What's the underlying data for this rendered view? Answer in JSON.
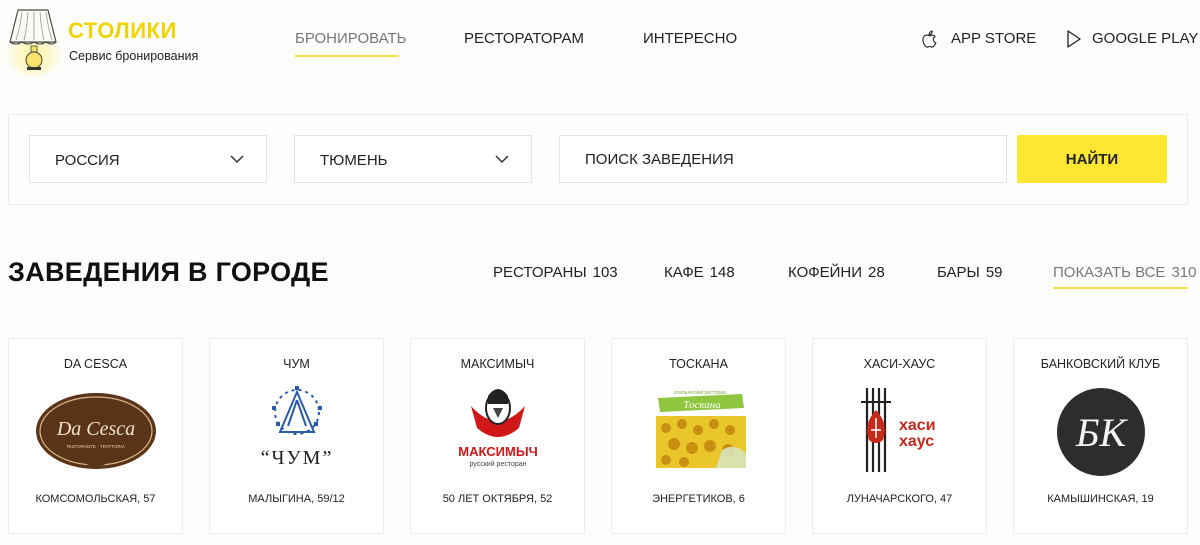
{
  "header": {
    "brand": "СТОЛИКИ",
    "tagline": "Сервис бронирования",
    "nav": [
      {
        "label": "БРОНИРОВАТЬ",
        "active": true
      },
      {
        "label": "РЕСТОРАТОРАМ",
        "active": false
      },
      {
        "label": "ИНТЕРЕСНО",
        "active": false
      }
    ],
    "stores": [
      {
        "label": "APP STORE",
        "icon": "apple-icon"
      },
      {
        "label": "GOOGLE PLAY",
        "icon": "play-icon"
      }
    ]
  },
  "search": {
    "country": "РОССИЯ",
    "city": "ТЮМЕНЬ",
    "placeholder": "ПОИСК ЗАВЕДЕНИЯ",
    "button": "НАЙТИ"
  },
  "section": {
    "title": "ЗАВЕДЕНИЯ В ГОРОДЕ",
    "filters": [
      {
        "label": "РЕСТОРАНЫ",
        "count": "103"
      },
      {
        "label": "КАФЕ",
        "count": "148"
      },
      {
        "label": "КОФЕЙНИ",
        "count": "28"
      },
      {
        "label": "БАРЫ",
        "count": "59"
      },
      {
        "label": "ПОКАЗАТЬ ВСЕ",
        "count": "310"
      }
    ]
  },
  "venues": [
    {
      "name": "DA CESCA",
      "address": "КОМСОМОЛЬСКАЯ, 57",
      "logo_text": "Da Cesca",
      "logo_sub": "RISTORANTE · TRATTORIA"
    },
    {
      "name": "ЧУМ",
      "address": "МАЛЫГИНА, 59/12",
      "logo_text": "“ЧУМ”"
    },
    {
      "name": "МАКСИМЫЧ",
      "address": "50 ЛЕТ ОКТЯБРЯ, 52",
      "logo_text": "МАКСИМЫЧ",
      "logo_sub": "русский ресторан"
    },
    {
      "name": "ТОСКАНА",
      "address": "ЭНЕРГЕТИКОВ, 6",
      "logo_text": "Тоскана",
      "logo_sub": "итальянский ресторан"
    },
    {
      "name": "ХАСИ-ХАУС",
      "address": "ЛУНАЧАРСКОГО, 47",
      "logo_text": "хаси",
      "logo_text2": "хаус"
    },
    {
      "name": "БАНКОВСКИЙ КЛУБ",
      "address": "КАМЫШИНСКАЯ, 19",
      "logo_text": "БК"
    }
  ],
  "colors": {
    "accent": "#ffe630",
    "brand": "#f0d400",
    "underline": "#f5e04a",
    "dacesca_brown": "#5a3418",
    "chum_blue": "#2a5aa8",
    "maksimych_red": "#d01818",
    "hasi_red": "#c8281a"
  }
}
